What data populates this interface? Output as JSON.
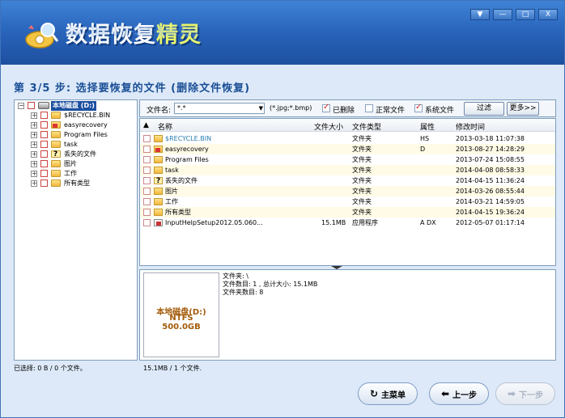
{
  "app": {
    "title_main": "数据恢复",
    "title_accent": "精灵"
  },
  "window_buttons": [
    "▼",
    "—",
    "□",
    "X"
  ],
  "step_title": "第 3/5 步: 选择要恢复的文件 (删除文件恢复)",
  "tree": [
    {
      "label": "本地磁盘 (D:)",
      "level": 0,
      "icon": "drive-icon",
      "selected": true
    },
    {
      "label": "$RECYCLE.BIN",
      "level": 1,
      "icon": "folder-icon"
    },
    {
      "label": "easyrecovery",
      "level": 1,
      "icon": "folder-deleted-icon"
    },
    {
      "label": "Program Files",
      "level": 1,
      "icon": "folder-icon"
    },
    {
      "label": "task",
      "level": 1,
      "icon": "folder-icon"
    },
    {
      "label": "丢失的文件",
      "level": 1,
      "icon": "lost-files-icon"
    },
    {
      "label": "图片",
      "level": 1,
      "icon": "folder-icon"
    },
    {
      "label": "工作",
      "level": 1,
      "icon": "folder-icon"
    },
    {
      "label": "所有类型",
      "level": 1,
      "icon": "folder-icon"
    }
  ],
  "filter": {
    "filename_label": "文件名:",
    "filename_value": "*.*",
    "ext_hint": "(*.jpg;*.bmp)",
    "deleted_label": "已删除",
    "deleted_checked": true,
    "normal_label": "正常文件",
    "normal_checked": false,
    "system_label": "系统文件",
    "system_checked": true,
    "filter_button": "过滤",
    "more_button": "更多>>"
  },
  "list": {
    "columns": {
      "name": "名称",
      "size": "文件大小",
      "type": "文件类型",
      "attr": "属性",
      "mtime": "修改时间"
    },
    "rows": [
      {
        "name": "$RECYCLE.BIN",
        "size": "",
        "type": "文件夹",
        "attr": "HS",
        "mtime": "2013-03-18 11:07:38",
        "icon": "folder-icon"
      },
      {
        "name": "easyrecovery",
        "size": "",
        "type": "文件夹",
        "attr": "D",
        "mtime": "2013-08-27 14:28:29",
        "icon": "folder-deleted-icon"
      },
      {
        "name": "Program Files",
        "size": "",
        "type": "文件夹",
        "attr": "",
        "mtime": "2013-07-24 15:08:55",
        "icon": "folder-icon"
      },
      {
        "name": "task",
        "size": "",
        "type": "文件夹",
        "attr": "",
        "mtime": "2014-04-08 08:58:33",
        "icon": "folder-icon"
      },
      {
        "name": "丢失的文件",
        "size": "",
        "type": "文件夹",
        "attr": "",
        "mtime": "2014-04-15 11:36:24",
        "icon": "lost-files-icon"
      },
      {
        "name": "图片",
        "size": "",
        "type": "文件夹",
        "attr": "",
        "mtime": "2014-03-26 08:55:44",
        "icon": "folder-icon"
      },
      {
        "name": "工作",
        "size": "",
        "type": "文件夹",
        "attr": "",
        "mtime": "2014-03-21 14:59:05",
        "icon": "folder-icon"
      },
      {
        "name": "所有类型",
        "size": "",
        "type": "文件夹",
        "attr": "",
        "mtime": "2014-04-15 19:36:24",
        "icon": "folder-icon"
      },
      {
        "name": "InputHelpSetup2012.05.060...",
        "size": "15.1MB",
        "type": "应用程序",
        "attr": "A DX",
        "mtime": "2012-05-07 01:17:14",
        "icon": "app-icon"
      }
    ]
  },
  "drive_card": {
    "name": "本地磁盘(D:)",
    "fs": "NTFS",
    "size": "500.0GB"
  },
  "info": {
    "folder": "文件夹: \\",
    "counts": "文件数目: 1 , 总计大小: 15.1MB",
    "folders": "文件夹数目: 8"
  },
  "status": {
    "left": "已选择: 0 B / 0 个文件。",
    "right": "15.1MB / 1 个文件."
  },
  "nav": {
    "main_menu": "主菜单",
    "prev": "上一步",
    "next": "下一步"
  },
  "colors": {
    "title_bg": "#2a66bd",
    "accent": "#e9f56e",
    "step_text": "#1a4f96",
    "highlight_folder": "#2a7db0",
    "drive_text": "#a35c0a"
  }
}
